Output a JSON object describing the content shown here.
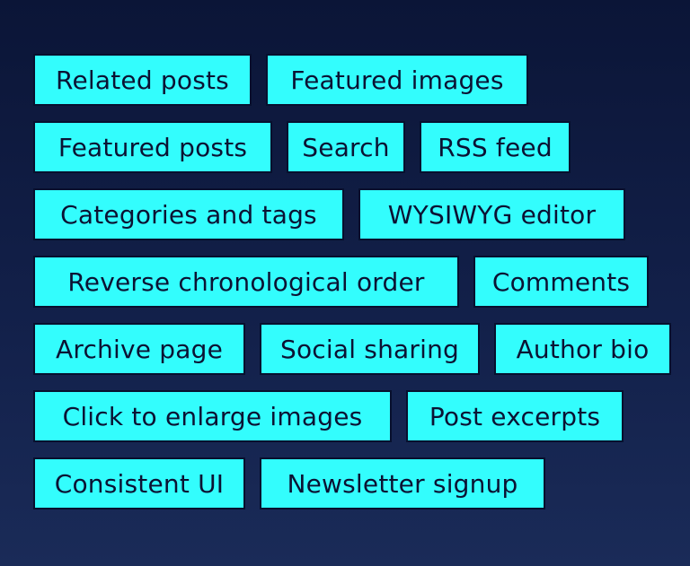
{
  "colors": {
    "tag_background": "#33fdfd",
    "tag_text": "#0b1233",
    "background": "#0b1537"
  },
  "tags": [
    [
      "Related posts",
      "Featured images"
    ],
    [
      "Featured posts",
      "Search",
      "RSS feed"
    ],
    [
      "Categories and tags",
      "WYSIWYG editor"
    ],
    [
      "Reverse chronological order",
      "Comments"
    ],
    [
      "Archive page",
      "Social sharing",
      "Author bio"
    ],
    [
      "Click to enlarge images",
      "Post excerpts"
    ],
    [
      "Consistent UI",
      "Newsletter signup"
    ]
  ]
}
